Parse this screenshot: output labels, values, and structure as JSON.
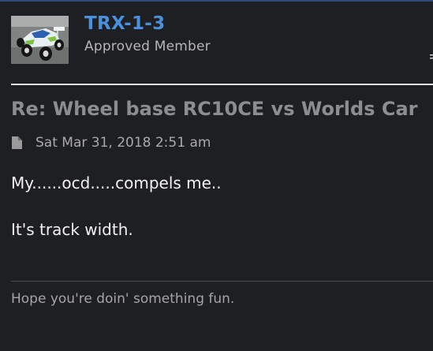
{
  "author": {
    "username": "TRX-1-3",
    "rank": "Approved Member",
    "avatar_icon": "rc-buggy-avatar"
  },
  "post": {
    "title": "Re: Wheel base RC10CE vs Worlds Car",
    "icon": "file-icon",
    "date": "Sat Mar 31, 2018 2:51 am",
    "content": {
      "line1": "My......ocd.....compels me..",
      "line2": "It's track width."
    },
    "signature": "Hope you're doin' something fun."
  },
  "colors": {
    "background": "#1e1f22",
    "username": "#4a90dd",
    "title": "#8c8d8f",
    "text": "#f2f2f2",
    "muted": "#a9a9a9"
  }
}
